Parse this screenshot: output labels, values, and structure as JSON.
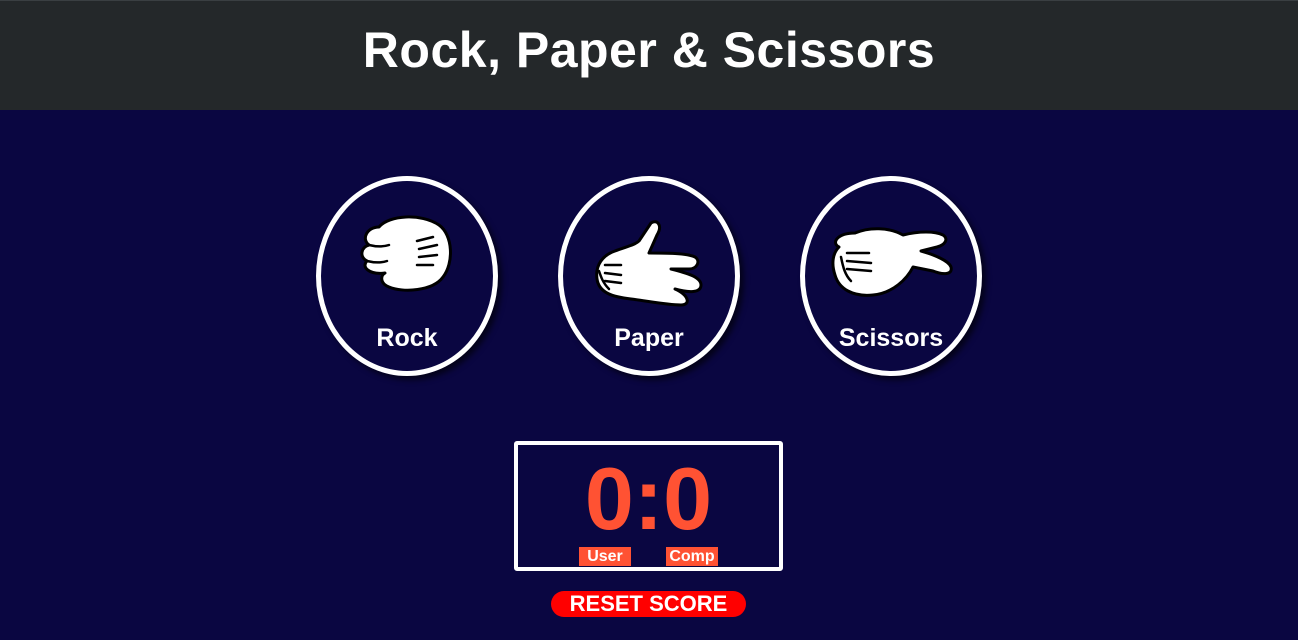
{
  "header": {
    "title": "Rock, Paper & Scissors"
  },
  "choices": [
    {
      "label": "Rock",
      "icon": "rock-fist-icon"
    },
    {
      "label": "Paper",
      "icon": "paper-hand-icon"
    },
    {
      "label": "Scissors",
      "icon": "scissors-hand-icon"
    }
  ],
  "scoreboard": {
    "score": "0:0",
    "user_label": "User",
    "comp_label": "Comp"
  },
  "reset_label": "RESET SCORE",
  "colors": {
    "background": "#0a0641",
    "header": "#24282a",
    "score": "#ff5233",
    "reset": "#ff0000",
    "text": "#ffffff"
  }
}
